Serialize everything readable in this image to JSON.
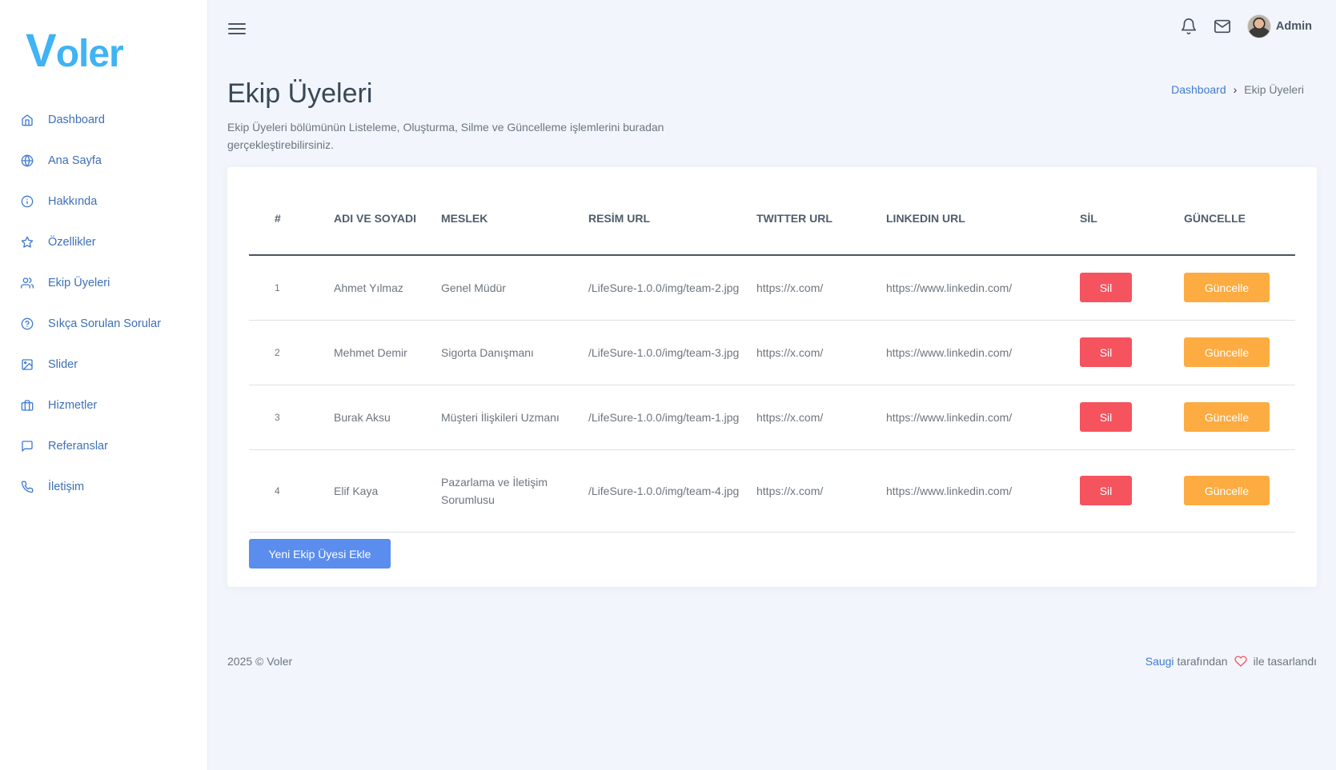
{
  "app": {
    "logo_first": "V",
    "logo_rest": "oler"
  },
  "sidebar": {
    "items": [
      {
        "label": "Dashboard",
        "icon": "home-icon"
      },
      {
        "label": "Ana Sayfa",
        "icon": "globe-icon"
      },
      {
        "label": "Hakkında",
        "icon": "info-icon"
      },
      {
        "label": "Özellikler",
        "icon": "star-icon"
      },
      {
        "label": "Ekip Üyeleri",
        "icon": "users-icon"
      },
      {
        "label": "Sıkça Sorulan Sorular",
        "icon": "help-circle-icon"
      },
      {
        "label": "Slider",
        "icon": "image-icon"
      },
      {
        "label": "Hizmetler",
        "icon": "briefcase-icon"
      },
      {
        "label": "Referanslar",
        "icon": "message-square-icon"
      },
      {
        "label": "İletişim",
        "icon": "phone-icon"
      }
    ]
  },
  "header": {
    "user_name": "Admin"
  },
  "page": {
    "title": "Ekip Üyeleri",
    "description": "Ekip Üyeleri bölümünün Listeleme, Oluşturma, Silme ve Güncelleme işlemlerini buradan gerçekleştirebilirsiniz.",
    "breadcrumb": {
      "home": "Dashboard",
      "separator": "›",
      "current": "Ekip Üyeleri"
    }
  },
  "table": {
    "headers": [
      "#",
      "ADI VE SOYADI",
      "MESLEK",
      "RESİM URL",
      "TWITTER URL",
      "LINKEDIN URL",
      "SİL",
      "GÜNCELLE"
    ],
    "rows": [
      {
        "num": "1",
        "name": "Ahmet Yılmaz",
        "job": "Genel Müdür",
        "img": "/LifeSure-1.0.0/img/team-2.jpg",
        "twitter": "https://x.com/",
        "linkedin": "https://www.linkedin.com/",
        "delete": "Sil",
        "update": "Güncelle"
      },
      {
        "num": "2",
        "name": "Mehmet Demir",
        "job": "Sigorta Danışmanı",
        "img": "/LifeSure-1.0.0/img/team-3.jpg",
        "twitter": "https://x.com/",
        "linkedin": "https://www.linkedin.com/",
        "delete": "Sil",
        "update": "Güncelle"
      },
      {
        "num": "3",
        "name": "Burak Aksu",
        "job": "Müşteri İlişkileri Uzmanı",
        "img": "/LifeSure-1.0.0/img/team-1.jpg",
        "twitter": "https://x.com/",
        "linkedin": "https://www.linkedin.com/",
        "delete": "Sil",
        "update": "Güncelle"
      },
      {
        "num": "4",
        "name": "Elif Kaya",
        "job": "Pazarlama ve İletişim Sorumlusu",
        "img": "/LifeSure-1.0.0/img/team-4.jpg",
        "twitter": "https://x.com/",
        "linkedin": "https://www.linkedin.com/",
        "delete": "Sil",
        "update": "Güncelle"
      }
    ],
    "add_button": "Yeni Ekip Üyesi Ekle"
  },
  "footer": {
    "copyright": "2025 © Voler",
    "author": "Saugi",
    "by": "tarafından",
    "designed": "ile tasarlandı"
  },
  "colors": {
    "accent": "#5a8dee",
    "danger": "#f5535e",
    "warning": "#fdac41",
    "logo": "#3fb3f3"
  }
}
